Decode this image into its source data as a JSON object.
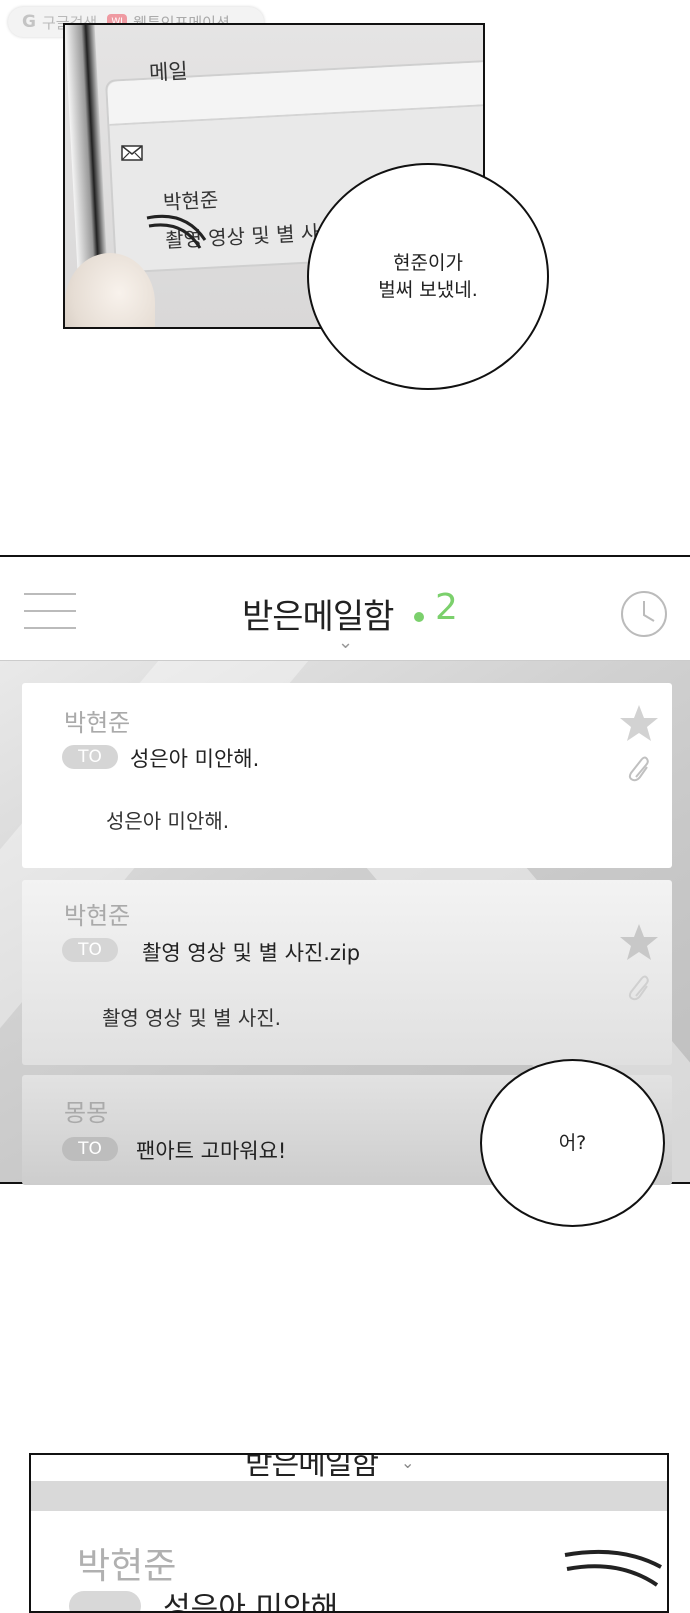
{
  "watermark": {
    "google_label": "구글검색",
    "site_badge": "WI",
    "site_label": "웹툰인포메이션"
  },
  "panel1": {
    "mail_title": "메일",
    "mail_sender": "박현준",
    "mail_subject": "촬영 영상 및 별 사진",
    "speech": "현준이가\n벌써 보냈네."
  },
  "panel2": {
    "header": {
      "title": "받은메일함",
      "unread_count": "2",
      "accent_color": "#7bd06c"
    },
    "mails": [
      {
        "sender": "박현준",
        "to_badge": "TO",
        "subject": "성은아 미안해.",
        "preview": "성은아 미안해."
      },
      {
        "sender": "박현준",
        "to_badge": "TO",
        "subject": "촬영 영상 및 별 사진.zip",
        "preview": "촬영 영상 및 별 사진."
      },
      {
        "sender": "몽몽",
        "to_badge": "TO",
        "subject": "팬아트 고마워요!"
      }
    ],
    "speech": "어?"
  },
  "panel3": {
    "title": "받은메일함",
    "sender": "박현준",
    "subject": "성은아 미안해"
  }
}
